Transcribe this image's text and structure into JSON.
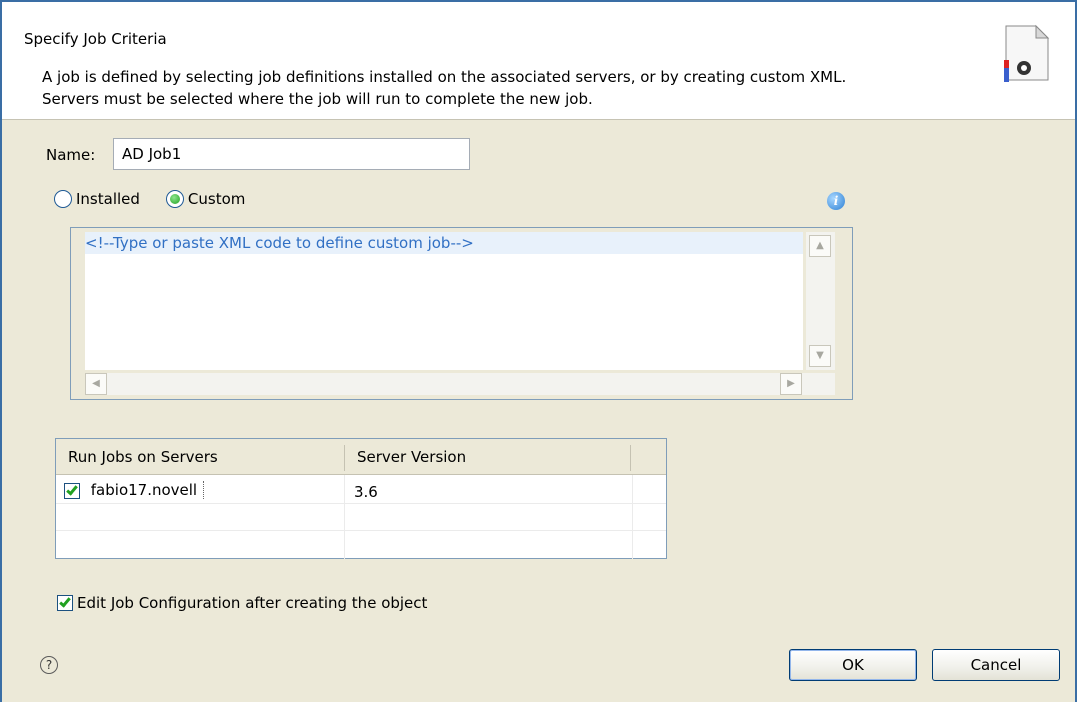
{
  "header": {
    "title": "Specify Job Criteria",
    "description_line1": "A job is defined by selecting job definitions installed on the associated servers, or by creating custom XML.",
    "description_line2": "Servers must be selected where the job will run to complete the new job.",
    "icon": "job-document-icon"
  },
  "name_field": {
    "label": "Name:",
    "value": "AD Job1"
  },
  "source": {
    "options": [
      "Installed",
      "Custom"
    ],
    "selected": "Custom"
  },
  "xml_editor": {
    "placeholder_text": "<!--Type or paste XML code to define custom job-->"
  },
  "servers_table": {
    "columns": [
      "Run Jobs on Servers",
      "Server Version"
    ],
    "rows": [
      {
        "checked": true,
        "server": "fabio17.novell",
        "version": "3.6"
      }
    ]
  },
  "edit_config": {
    "checked": true,
    "label": "Edit Job Configuration after creating the object"
  },
  "footer": {
    "help_icon": "help-icon",
    "ok_label": "OK",
    "cancel_label": "Cancel"
  }
}
